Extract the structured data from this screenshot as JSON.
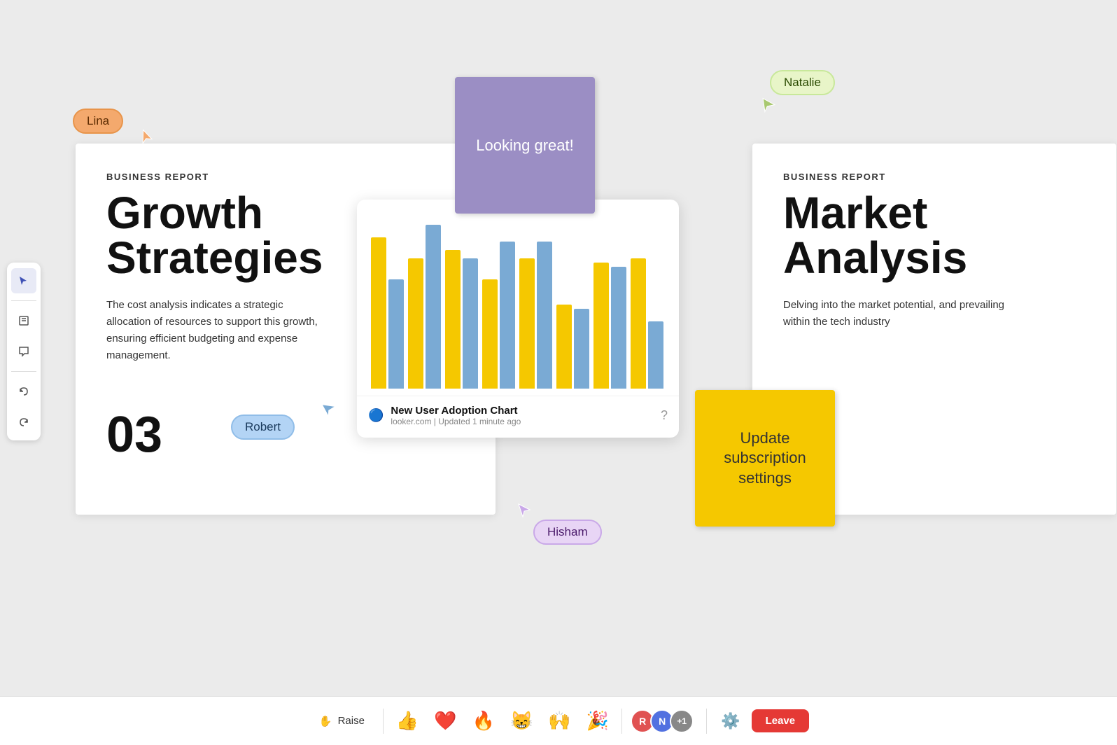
{
  "canvas": {
    "background": "#ebebeb"
  },
  "toolbar": {
    "tools": [
      {
        "name": "cursor",
        "icon": "▶",
        "active": true
      },
      {
        "name": "sticky-note",
        "icon": "🗒",
        "active": false
      },
      {
        "name": "comment",
        "icon": "💬",
        "active": false
      },
      {
        "name": "undo",
        "icon": "↩",
        "active": false
      },
      {
        "name": "redo",
        "icon": "↪",
        "active": false
      }
    ]
  },
  "doc_main": {
    "label": "BUSINESS REPORT",
    "title": "Growth Strategies",
    "body": "The cost analysis indicates a strategic allocation of resources to support this growth, ensuring efficient budgeting and expense management.",
    "number": "03"
  },
  "doc_right": {
    "label": "BUSINESS REPORT",
    "title": "Market Analysis",
    "body": "Delving into the market potential, and prevailing within the tech industry"
  },
  "sticky_purple": {
    "text": "Looking great!"
  },
  "sticky_yellow": {
    "text": "Update subscription settings"
  },
  "chart": {
    "title": "New User Adoption Chart",
    "source": "looker.com",
    "updated": "Updated 1 minute ago",
    "bars": [
      {
        "yellow": 180,
        "blue": 130
      },
      {
        "yellow": 155,
        "blue": 195
      },
      {
        "yellow": 165,
        "blue": 155
      },
      {
        "yellow": 130,
        "blue": 175
      },
      {
        "yellow": 155,
        "blue": 175
      },
      {
        "yellow": 100,
        "blue": 95
      },
      {
        "yellow": 150,
        "blue": 145
      },
      {
        "yellow": 155,
        "blue": 80
      }
    ]
  },
  "users": [
    {
      "name": "Lina",
      "color_class": "user-label-lina"
    },
    {
      "name": "Robert",
      "color_class": "user-label-robert"
    },
    {
      "name": "Hisham",
      "color_class": "user-label-hisham"
    },
    {
      "name": "Natalie",
      "color_class": "user-label-natalie"
    }
  ],
  "bottom_bar": {
    "raise_label": "Raise",
    "leave_label": "Leave",
    "emojis": [
      "👍",
      "❤️",
      "🔥",
      "😸",
      "🙌",
      "🎉"
    ],
    "settings_icon": "⚙️",
    "extra_count": "+1"
  }
}
